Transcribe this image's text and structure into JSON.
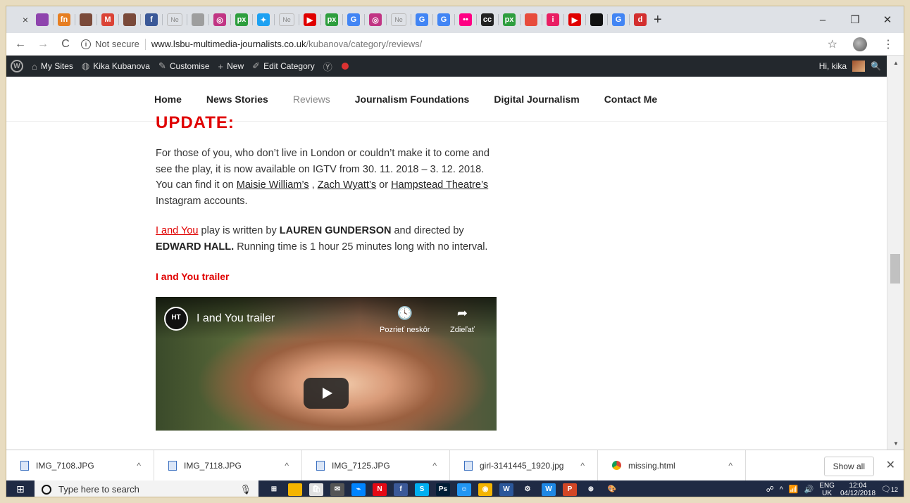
{
  "browser": {
    "tab_close": "×",
    "favicons": [
      {
        "name": "purple-square-icon",
        "color": "#8e44ad",
        "glyph": ""
      },
      {
        "name": "fn-icon",
        "color": "#e67e22",
        "glyph": "fn"
      },
      {
        "name": "profile-photo-icon",
        "color": "#7a4a3a",
        "glyph": ""
      },
      {
        "name": "gmail-icon",
        "color": "#db4437",
        "glyph": "M"
      },
      {
        "name": "profile-photo-icon",
        "color": "#7a4a3a",
        "glyph": ""
      },
      {
        "name": "facebook-icon",
        "color": "#3b5998",
        "glyph": "f"
      },
      {
        "name": "page-icon",
        "color": "#9e9e9e",
        "glyph": ""
      },
      {
        "name": "instagram-icon",
        "color": "#c13584",
        "glyph": "◎"
      },
      {
        "name": "500px-icon",
        "color": "#2e9e3e",
        "glyph": "px"
      },
      {
        "name": "twitter-icon",
        "color": "#1da1f2",
        "glyph": "✦"
      },
      {
        "name": "youtube-icon",
        "color": "#e00000",
        "glyph": "▶"
      },
      {
        "name": "500px-icon",
        "color": "#2e9e3e",
        "glyph": "px"
      },
      {
        "name": "google-icon",
        "color": "#4285f4",
        "glyph": "G"
      },
      {
        "name": "instagram-icon",
        "color": "#c13584",
        "glyph": "◎"
      },
      {
        "name": "google-icon",
        "color": "#4285f4",
        "glyph": "G"
      },
      {
        "name": "google-icon",
        "color": "#4285f4",
        "glyph": "G"
      },
      {
        "name": "flickr-icon",
        "color": "#ff0084",
        "glyph": "••"
      },
      {
        "name": "creative-commons-icon",
        "color": "#222222",
        "glyph": "cc"
      },
      {
        "name": "500px-icon",
        "color": "#2e9e3e",
        "glyph": "px"
      },
      {
        "name": "red-app-icon",
        "color": "#e74c3c",
        "glyph": ""
      },
      {
        "name": "info-i-icon",
        "color": "#e91e63",
        "glyph": "i"
      },
      {
        "name": "youtube-icon",
        "color": "#e00000",
        "glyph": "▶"
      },
      {
        "name": "black-square-icon",
        "color": "#111111",
        "glyph": ""
      },
      {
        "name": "google-icon",
        "color": "#4285f4",
        "glyph": "G"
      },
      {
        "name": "red-circle-icon",
        "color": "#d32f2f",
        "glyph": "d"
      }
    ],
    "tab_text_favicon": "Ne",
    "new_tab": "+",
    "window_controls": [
      "–",
      "❐",
      "✕"
    ],
    "address": {
      "back": "←",
      "forward": "→",
      "reload": "C",
      "info": "i",
      "security_label": "Not secure",
      "url_host": "www.lsbu-multimedia-journalists.co.uk",
      "url_path": "/kubanova/category/reviews/"
    },
    "star": "☆",
    "menu": "⋮"
  },
  "wpbar": {
    "logo": "W",
    "my_sites": "My Sites",
    "site_name": "Kika Kubanova",
    "customise": "Customise",
    "new": "New",
    "edit_category": "Edit Category",
    "greeting": "Hi, kika",
    "search_glyph": "🔍"
  },
  "site_nav": {
    "items": [
      "Home",
      "News Stories",
      "Reviews",
      "Journalism Foundations",
      "Digital Journalism",
      "Contact Me"
    ]
  },
  "article": {
    "update_heading": "UPDATE:",
    "p1": {
      "t1": "For those of you, who don’t live in London or couldn’t make it to come and see the play, it is now available on IGTV from 30. 11. 2018 – 3. 12. 2018. You can find it on ",
      "link1": "Maisie William’s",
      "t2": " , ",
      "link2": "Zach Wyatt’s",
      "t3": " or ",
      "link3": "Hampstead Theatre’s",
      "t4": " Instagram accounts."
    },
    "p2": {
      "link": "I and You",
      "t1": " play is written by ",
      "b1": "LAUREN GUNDERSON",
      "t2": " and directed by ",
      "b2": "EDWARD HALL.",
      "t3": " Running time is 1 hour 25 minutes long with no interval."
    },
    "trailer_heading": "I and You trailer",
    "video": {
      "logo": "HT",
      "title": "I and You trailer",
      "watch_later": "Pozrieť neskôr",
      "share": "Zdieľať"
    }
  },
  "downloads": {
    "items": [
      {
        "name": "IMG_7108.JPG",
        "type": "image"
      },
      {
        "name": "IMG_7118.JPG",
        "type": "image"
      },
      {
        "name": "IMG_7125.JPG",
        "type": "image"
      },
      {
        "name": "girl-3141445_1920.jpg",
        "type": "image"
      },
      {
        "name": "missing.html",
        "type": "chrome"
      }
    ],
    "show_all": "Show all",
    "close": "✕"
  },
  "taskbar": {
    "search_placeholder": "Type here to search",
    "apps": [
      {
        "name": "task-view-icon",
        "color": "#1f2a44",
        "glyph": "⊞"
      },
      {
        "name": "file-explorer-icon",
        "color": "#f4b400",
        "glyph": ""
      },
      {
        "name": "store-icon",
        "color": "#e0e0e0",
        "glyph": "🛍"
      },
      {
        "name": "mail-icon",
        "color": "#555555",
        "glyph": "✉"
      },
      {
        "name": "messenger-icon",
        "color": "#0084ff",
        "glyph": "⌁"
      },
      {
        "name": "netflix-icon",
        "color": "#e50914",
        "glyph": "N"
      },
      {
        "name": "facebook-icon",
        "color": "#3b5998",
        "glyph": "f"
      },
      {
        "name": "skype-icon",
        "color": "#00aff0",
        "glyph": "S"
      },
      {
        "name": "photoshop-icon",
        "color": "#001e36",
        "glyph": "Ps"
      },
      {
        "name": "chat-icon",
        "color": "#2196f3",
        "glyph": "☺"
      },
      {
        "name": "chrome-icon",
        "color": "#f4b400",
        "glyph": "◉"
      },
      {
        "name": "word-icon",
        "color": "#2b579a",
        "glyph": "W"
      },
      {
        "name": "settings-icon",
        "color": "#1f2a44",
        "glyph": "⚙"
      },
      {
        "name": "app-blue-icon",
        "color": "#1e88e5",
        "glyph": "W"
      },
      {
        "name": "powerpoint-icon",
        "color": "#d24726",
        "glyph": "P"
      },
      {
        "name": "app-icon",
        "color": "#1f2a44",
        "glyph": "⊛"
      },
      {
        "name": "paint-icon",
        "color": "#1f2a44",
        "glyph": "🎨"
      }
    ],
    "lang_top": "ENG",
    "lang_bottom": "UK",
    "time": "12:04",
    "date": "04/12/2018",
    "notifications": "12"
  }
}
